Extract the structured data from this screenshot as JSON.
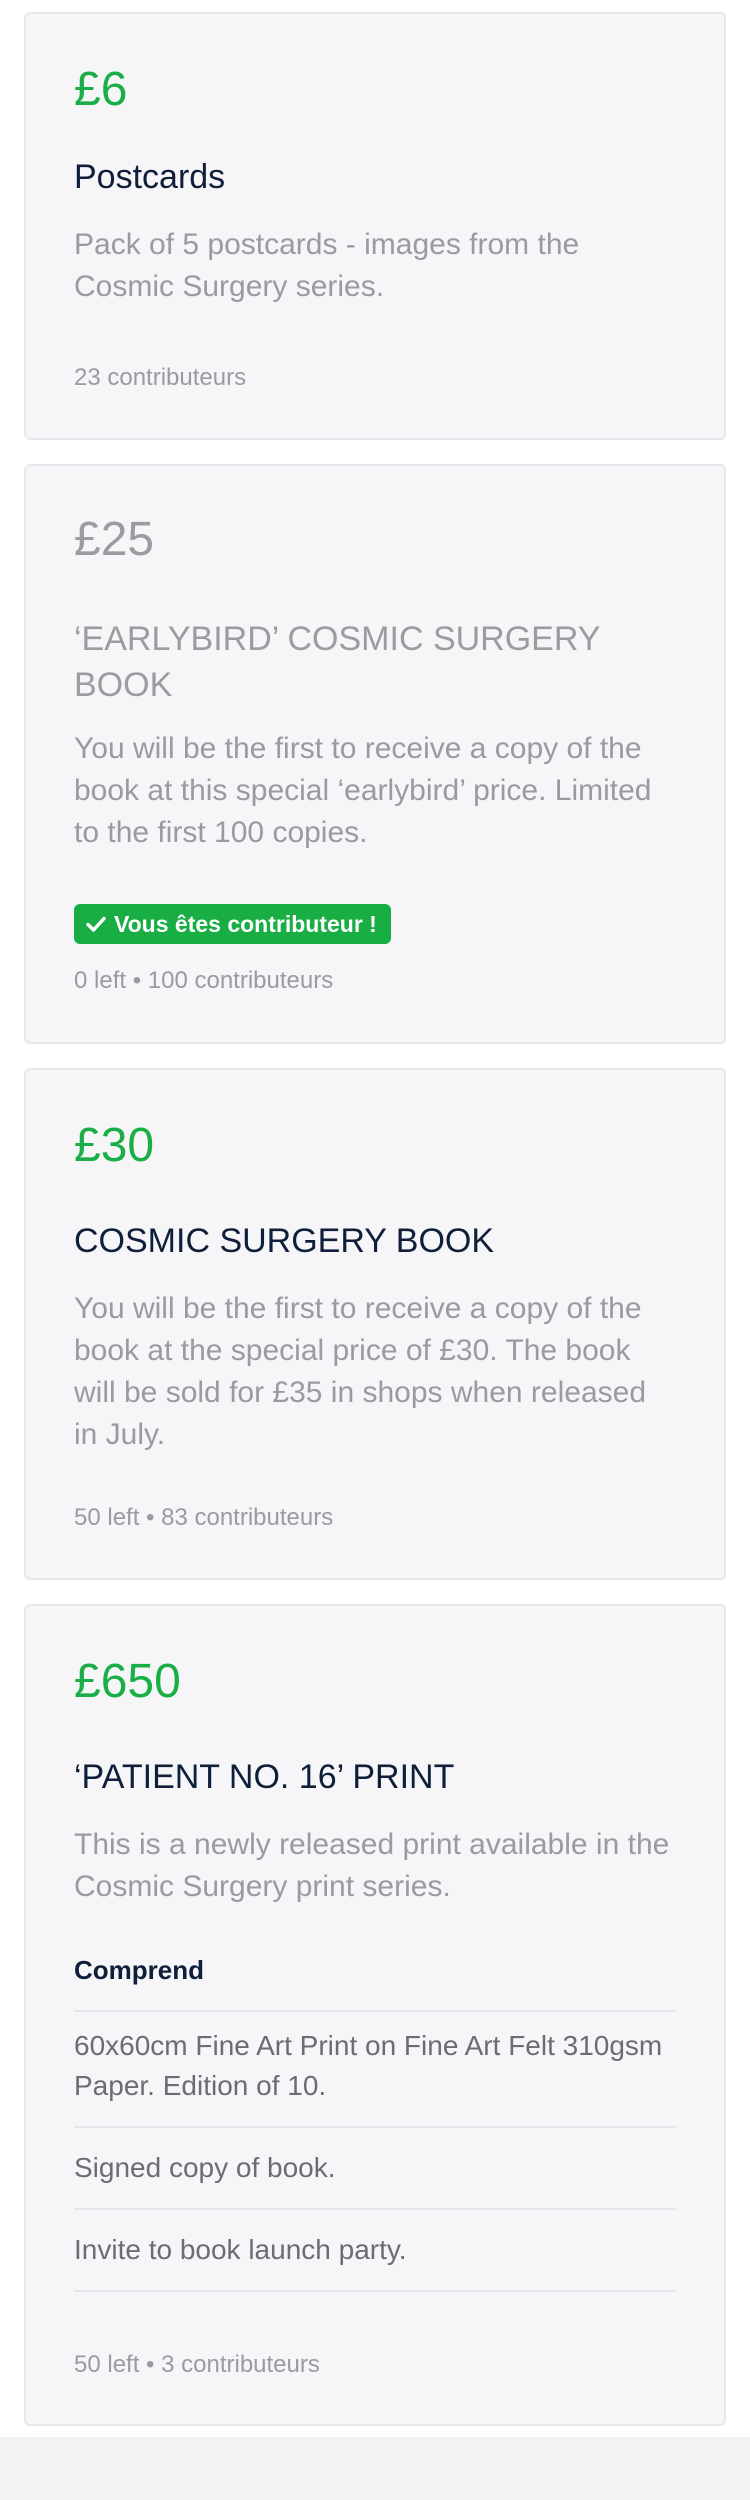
{
  "rewards": [
    {
      "price": "£6",
      "title": "Postcards",
      "description": "Pack of 5 postcards - images from the Cosmic Surgery series.",
      "meta": "23 contributeurs",
      "available": true
    },
    {
      "price": "£25",
      "title": "‘EARLYBIRD’ COSMIC SURGERY BOOK",
      "description": "You will be the first to receive a copy of the book at this special ‘earlybird’ price. Limited to the first 100 copies.",
      "badge": "Vous êtes contributeur !",
      "meta": "0 left • 100 contributeurs",
      "available": false
    },
    {
      "price": "£30",
      "title": "COSMIC SURGERY BOOK",
      "description": "You will be the first to receive a copy of the book at the special price of £30. The book will be sold for £35 in shops when released in July.",
      "meta": "50 left • 83 contributeurs",
      "available": true
    },
    {
      "price": "£650",
      "title": "‘PATIENT NO. 16’ PRINT",
      "description": "This is a newly released print available in the Cosmic Surgery print series.",
      "includes_heading": "Comprend",
      "includes": [
        "60x60cm Fine Art Print on Fine Art Felt 310gsm Paper. Edition of 10.",
        "Signed copy of book.",
        "Invite to book launch party."
      ],
      "meta": "50 left • 3 contributeurs",
      "available": true
    }
  ],
  "colors": {
    "accent": "#1aaf46",
    "badge": "#18ae44",
    "muted": "#9c9ca0",
    "title": "#0f1f3a",
    "card_bg": "#f6f6f8"
  },
  "icons": {
    "badge_icon": "check-icon"
  }
}
